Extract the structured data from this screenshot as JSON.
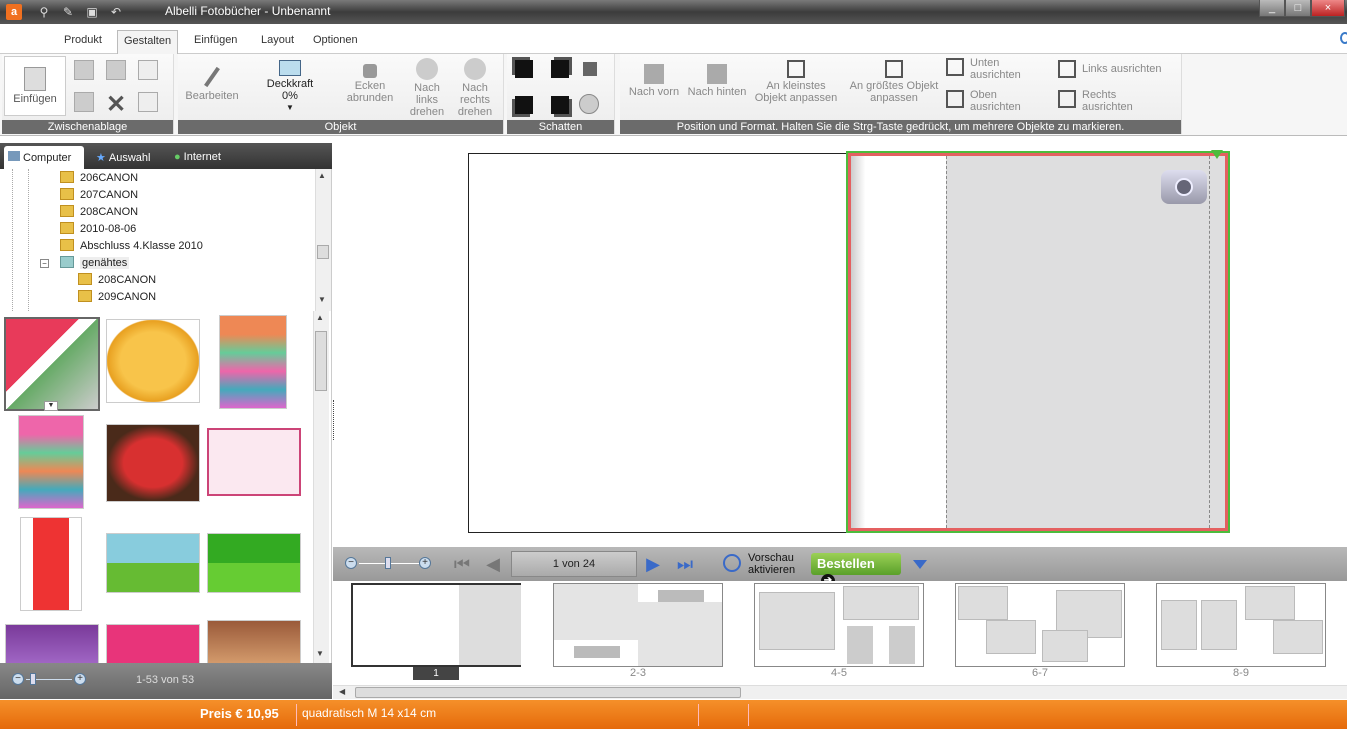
{
  "titlebar": {
    "title": "Albelli Fotobücher - Unbenannt",
    "app_icon": "a",
    "min": "_",
    "max": "□",
    "close": "×"
  },
  "menu": {
    "tabs": [
      "Produkt",
      "Gestalten",
      "Einfügen",
      "Layout",
      "Optionen"
    ],
    "active": "Gestalten"
  },
  "ribbon": {
    "clipboard": {
      "paste": "Einfügen",
      "label": "Zwischenablage"
    },
    "object": {
      "edit": "Bearbeiten",
      "opacity_label": "Deckkraft",
      "opacity_value": "0%",
      "round_corners": "Ecken abrunden",
      "rotate_left": "Nach links drehen",
      "rotate_right": "Nach rechts drehen",
      "label": "Objekt"
    },
    "shadow": {
      "label": "Schatten"
    },
    "position": {
      "to_front": "Nach vorn",
      "to_back": "Nach hinten",
      "fit_smallest": "An kleinstes Objekt anpassen",
      "fit_largest": "An größtes Objekt anpassen",
      "align_bottom": "Unten ausrichten",
      "align_top": "Oben ausrichten",
      "align_left": "Links ausrichten",
      "align_right": "Rechts ausrichten",
      "label": "Position und Format. Halten Sie die Strg-Taste gedrückt, um mehrere Objekte zu markieren."
    }
  },
  "left_tabs": [
    "Computer",
    "Auswahl",
    "Internet"
  ],
  "tree": [
    "206CANON",
    "207CANON",
    "208CANON",
    "2010-08-06",
    "Abschluss 4.Klasse 2010",
    "genähtes",
    "208CANON",
    "209CANON"
  ],
  "thumb_footer": "1-53 von 53",
  "nav": {
    "page_info": "1 von 24",
    "preview": "Vorschau aktivieren",
    "order": "Bestellen"
  },
  "pages": [
    "1",
    "2-3",
    "4-5",
    "6-7",
    "8-9"
  ],
  "status": {
    "price": "Preis € 10,95",
    "format": "quadratisch M 14 x14 cm"
  },
  "colors": {
    "accent": "#e56a0a",
    "selection_red": "#e46060",
    "selection_green": "#4cbc3c"
  }
}
